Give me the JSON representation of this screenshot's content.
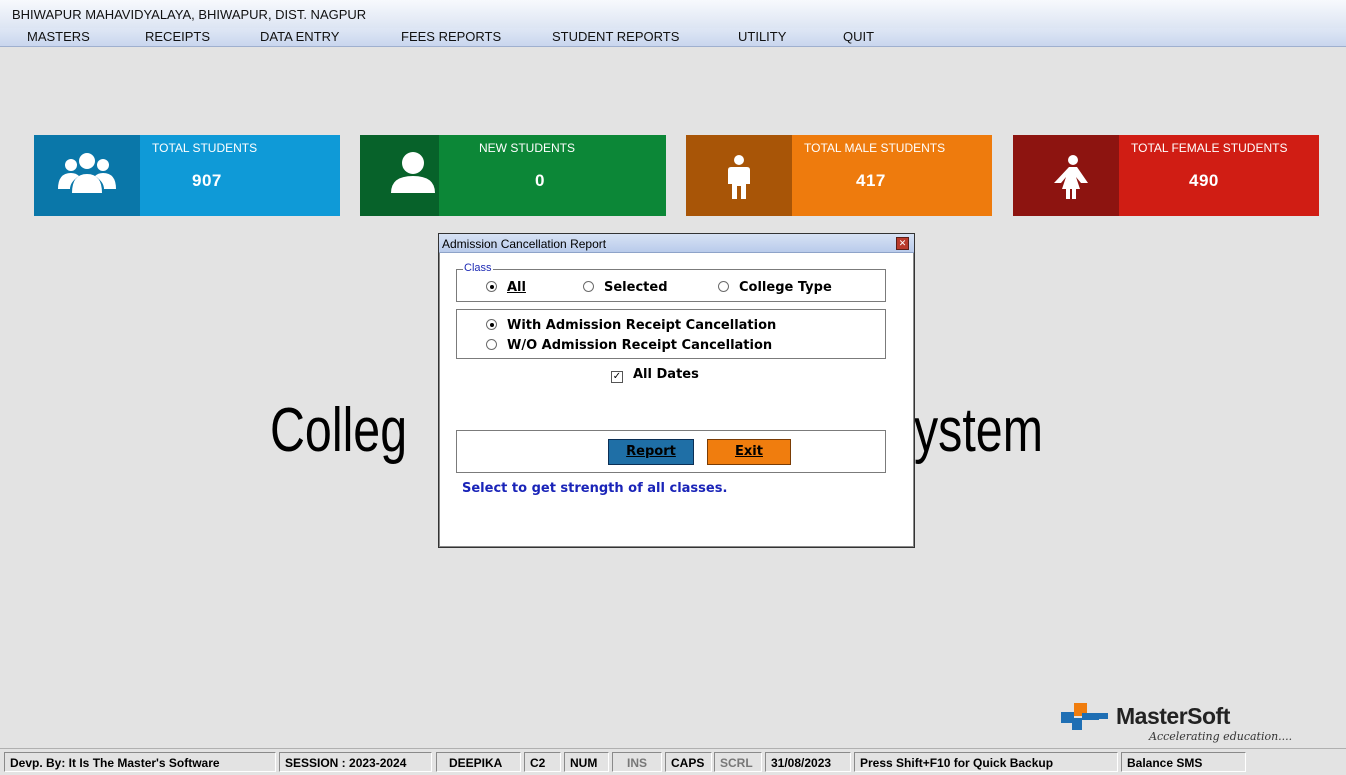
{
  "window": {
    "title": "BHIWAPUR MAHAVIDYALAYA, BHIWAPUR, DIST. NAGPUR"
  },
  "menu": [
    "MASTERS",
    "RECEIPTS",
    "DATA ENTRY",
    "FEES REPORTS",
    "STUDENT REPORTS",
    "UTILITY",
    "QUIT"
  ],
  "cards": [
    {
      "label": "TOTAL STUDENTS",
      "value": "907",
      "icon": "users-group-icon",
      "color": "#0f9ad7",
      "icon_bg": "#0a77a9"
    },
    {
      "label": "NEW STUDENTS",
      "value": "0",
      "icon": "user-icon",
      "color": "#0c8737",
      "icon_bg": "#07622a"
    },
    {
      "label": "TOTAL MALE STUDENTS",
      "value": "417",
      "icon": "male-icon",
      "color": "#ee7b0d",
      "icon_bg": "#a85507"
    },
    {
      "label": "TOTAL FEMALE STUDENTS",
      "value": "490",
      "icon": "female-icon",
      "color": "#d01d14",
      "icon_bg": "#8d1410"
    }
  ],
  "background_text": {
    "left": "Colleg",
    "right": "ystem"
  },
  "dialog": {
    "title": "Admission Cancellation Report",
    "class_group_label": "Class",
    "class_options": [
      {
        "label": "All",
        "selected": true
      },
      {
        "label": "Selected",
        "selected": false
      },
      {
        "label": "College Type",
        "selected": false
      }
    ],
    "receipt_options": [
      {
        "label": "With Admission Receipt Cancellation",
        "selected": true
      },
      {
        "label": "W/O Admission Receipt Cancellation",
        "selected": false
      }
    ],
    "all_dates": {
      "label": "All Dates",
      "checked": true
    },
    "report_button": "Report",
    "exit_button": "Exit",
    "hint": "Select to get strength of all classes."
  },
  "logo": {
    "name": "MasterSoft",
    "tagline": "Accelerating education....",
    "icon": "mastersoft-logo-icon"
  },
  "statusbar": [
    "Devp. By: It Is The Master's Software",
    "SESSION : 2023-2024",
    "DEEPIKA",
    "C2",
    "NUM",
    "INS",
    "CAPS",
    "SCRL",
    "31/08/2023",
    "Press Shift+F10 for Quick Backup",
    "Balance SMS"
  ],
  "colors": {
    "accent": "#1a24b8",
    "report_button": "#1f6fa6",
    "exit_button": "#f07d0e"
  }
}
